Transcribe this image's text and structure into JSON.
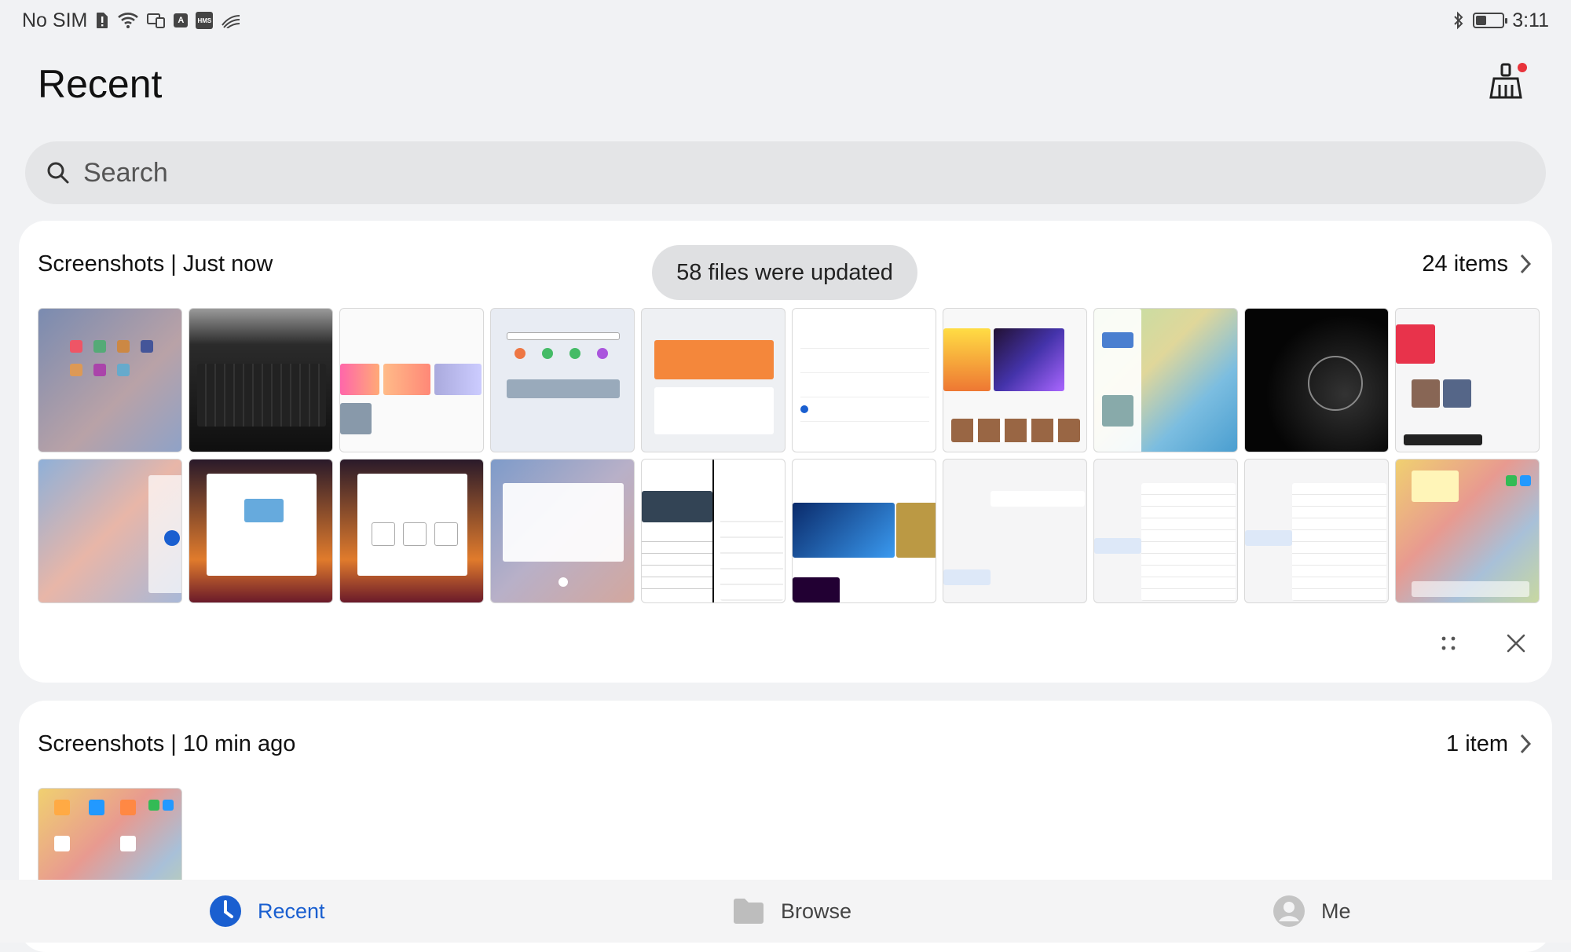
{
  "status": {
    "carrier": "No SIM",
    "time": "3:11",
    "battery_level": 0.35
  },
  "header": {
    "title": "Recent",
    "clean_icon": "broom-icon"
  },
  "search": {
    "placeholder": "Search"
  },
  "toast": "58 files were updated",
  "groups": [
    {
      "title": "Screenshots | Just now",
      "count": "24 items"
    },
    {
      "title": "Screenshots | 10 min ago",
      "count": "1 item"
    }
  ],
  "nav": {
    "recent": "Recent",
    "browse": "Browse",
    "me": "Me"
  },
  "colors": {
    "accent": "#1a5fd0",
    "badge": "#e8333b"
  }
}
